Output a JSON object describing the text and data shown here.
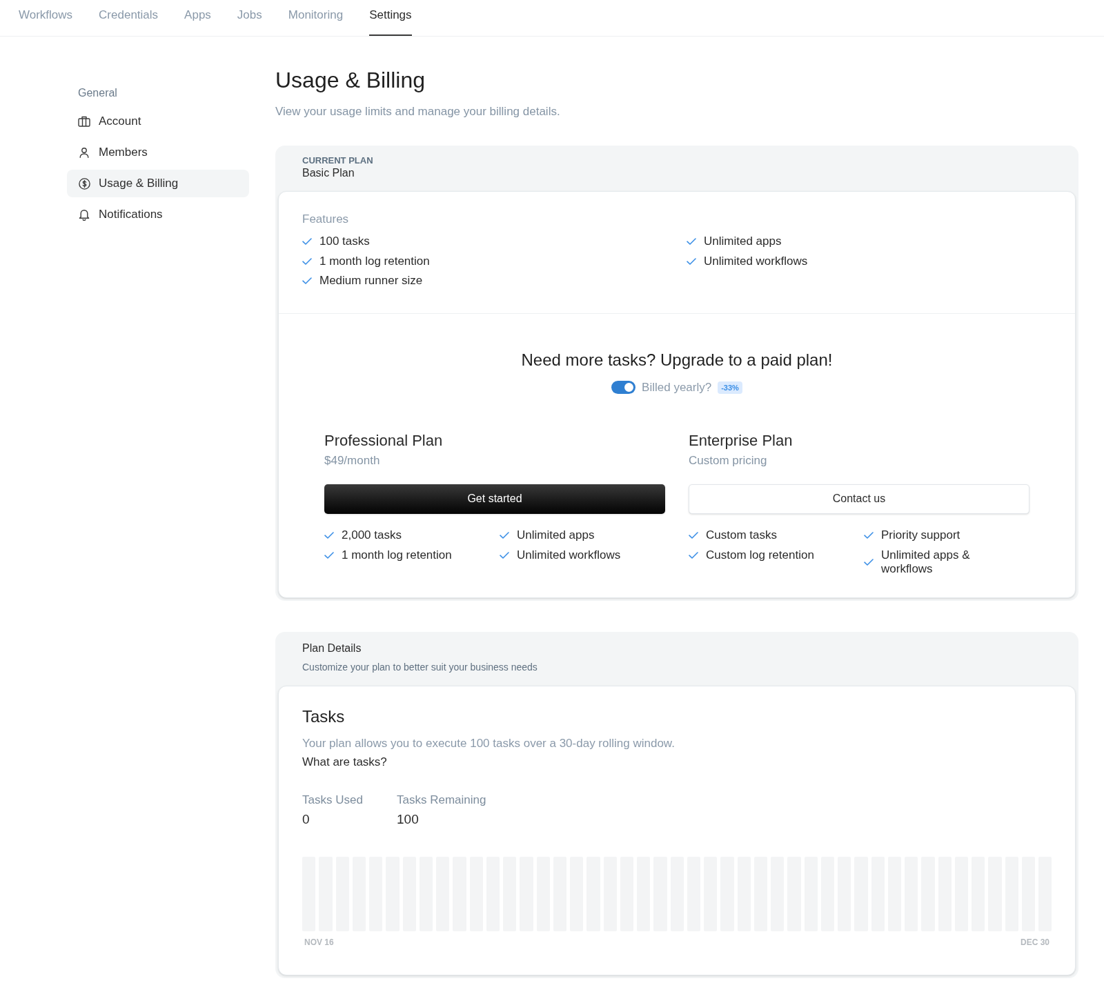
{
  "nav": {
    "tabs": [
      {
        "label": "Workflows",
        "selected": false
      },
      {
        "label": "Credentials",
        "selected": false
      },
      {
        "label": "Apps",
        "selected": false
      },
      {
        "label": "Jobs",
        "selected": false
      },
      {
        "label": "Monitoring",
        "selected": false
      },
      {
        "label": "Settings",
        "selected": true
      }
    ]
  },
  "sidebar": {
    "section": "General",
    "items": [
      {
        "label": "Account",
        "selected": false
      },
      {
        "label": "Members",
        "selected": false
      },
      {
        "label": "Usage & Billing",
        "selected": true
      },
      {
        "label": "Notifications",
        "selected": false
      }
    ]
  },
  "page": {
    "title": "Usage & Billing",
    "subtitle": "View your usage limits and manage your billing details."
  },
  "current_plan": {
    "label": "CURRENT PLAN",
    "name": "Basic Plan",
    "features_label": "Features",
    "feature_columns": [
      [
        "100 tasks",
        "1 month log retention",
        "Medium runner size"
      ],
      [
        "Unlimited apps",
        "Unlimited workflows"
      ]
    ]
  },
  "upgrade": {
    "heading": "Need more tasks? Upgrade to a paid plan!",
    "billing_toggle": {
      "label": "Billed yearly?",
      "on": true,
      "badge": "-33%"
    },
    "plans": [
      {
        "name": "Professional Plan",
        "price": "$49/month",
        "button": {
          "label": "Get started",
          "kind": "primary"
        },
        "feature_columns": [
          [
            "2,000 tasks",
            "1 month log retention"
          ],
          [
            "Unlimited apps",
            "Unlimited workflows"
          ]
        ]
      },
      {
        "name": "Enterprise Plan",
        "price": "Custom pricing",
        "button": {
          "label": "Contact us",
          "kind": "secondary"
        },
        "feature_columns": [
          [
            "Custom tasks",
            "Custom log retention"
          ],
          [
            "Priority support",
            "Unlimited apps & workflows"
          ]
        ]
      }
    ]
  },
  "plan_details": {
    "title": "Plan Details",
    "subtitle": "Customize your plan to better suit your business needs",
    "tasks": {
      "heading": "Tasks",
      "description": "Your plan allows you to execute 100 tasks over a 30-day rolling window.",
      "help_link": "What are tasks?",
      "stats": [
        {
          "label": "Tasks Used",
          "value": "0"
        },
        {
          "label": "Tasks Remaining",
          "value": "100"
        }
      ],
      "chart": {
        "start_label": "NOV 16",
        "end_label": "DEC 30"
      }
    }
  }
}
